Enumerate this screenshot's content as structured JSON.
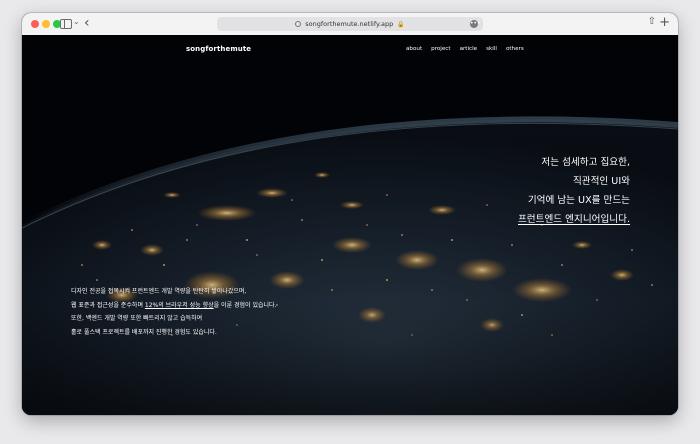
{
  "browser": {
    "url": "songforthemute.netlify.app"
  },
  "site": {
    "logo": "songforthemute",
    "nav": [
      "about",
      "project",
      "article",
      "skill",
      "others"
    ]
  },
  "hero": {
    "lines": [
      "저는 섬세하고 집요한,",
      "직관적인 UI와",
      "기억에 남는 UX를 만드는",
      "프런트엔드 엔지니어입니다."
    ]
  },
  "intro": {
    "line1": "디자인 전공을 접목시켜 프런트엔드 개발 역량을 탄탄히 쌓아나갔으며,",
    "line2_pre": "웹 표준과 접근성을 준수하며 ",
    "line2_highlight": "12%의 브라우저 성능 향상",
    "line2_post": "을 이룬 경험이 있습니다.",
    "line3": "또한, 백엔드 개발 역량 또한 빠트리지 않고 습득하여",
    "line4": "홀로 풀스택 프로젝트를 배포까지 진행한 경험도 있습니다."
  }
}
